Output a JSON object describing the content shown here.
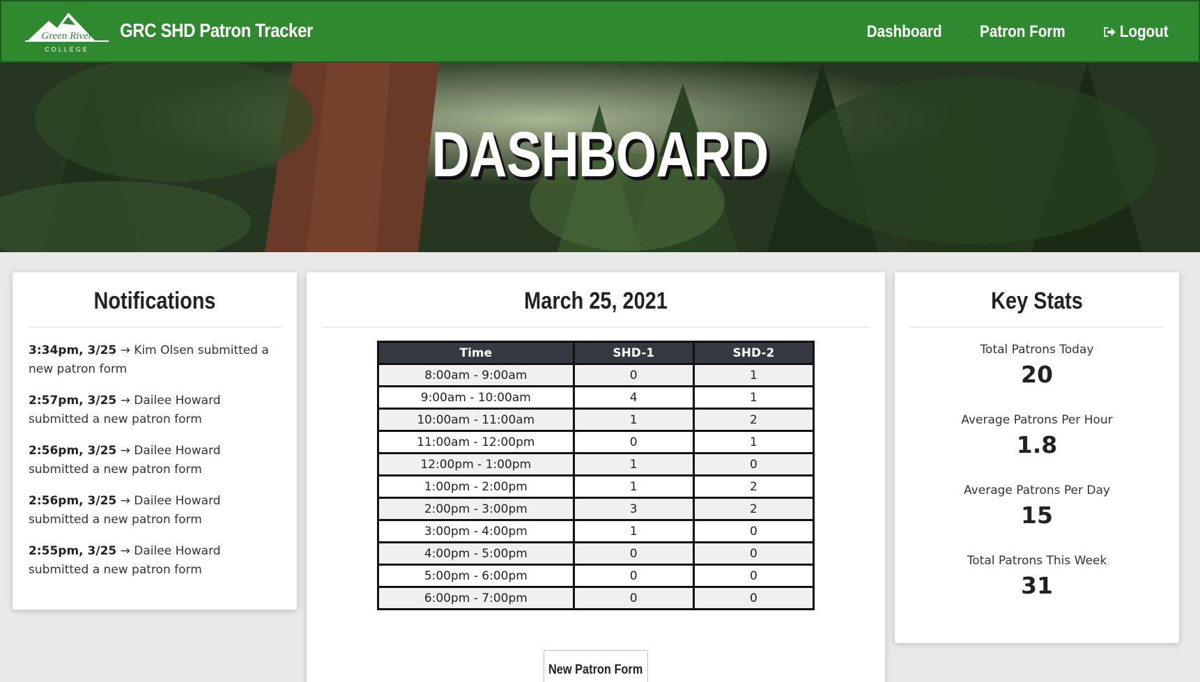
{
  "navbar": {
    "logo_text_top": "Green River",
    "logo_text_bottom": "COLLEGE",
    "brand": "GRC SHD Patron Tracker",
    "links": [
      "Dashboard",
      "Patron Form"
    ],
    "logout_label": "Logout"
  },
  "hero": {
    "title": "DASHBOARD"
  },
  "notifications": {
    "title": "Notifications",
    "items": [
      {
        "time": "3:34pm, 3/25",
        "text": " → Kim Olsen submitted a new patron form"
      },
      {
        "time": "2:57pm, 3/25",
        "text": " → Dailee Howard submitted a new patron form"
      },
      {
        "time": "2:56pm, 3/25",
        "text": " → Dailee Howard submitted a new patron form"
      },
      {
        "time": "2:56pm, 3/25",
        "text": " → Dailee Howard submitted a new patron form"
      },
      {
        "time": "2:55pm, 3/25",
        "text": " → Dailee Howard submitted a new patron form"
      }
    ]
  },
  "schedule": {
    "title": "March 25, 2021",
    "columns": [
      "Time",
      "SHD-1",
      "SHD-2"
    ],
    "rows": [
      [
        "8:00am - 9:00am",
        "0",
        "1"
      ],
      [
        "9:00am - 10:00am",
        "4",
        "1"
      ],
      [
        "10:00am - 11:00am",
        "1",
        "2"
      ],
      [
        "11:00am - 12:00pm",
        "0",
        "1"
      ],
      [
        "12:00pm - 1:00pm",
        "1",
        "0"
      ],
      [
        "1:00pm - 2:00pm",
        "1",
        "2"
      ],
      [
        "2:00pm - 3:00pm",
        "3",
        "2"
      ],
      [
        "3:00pm - 4:00pm",
        "1",
        "0"
      ],
      [
        "4:00pm - 5:00pm",
        "0",
        "0"
      ],
      [
        "5:00pm - 6:00pm",
        "0",
        "0"
      ],
      [
        "6:00pm - 7:00pm",
        "0",
        "0"
      ]
    ],
    "button_label": "New Patron Form"
  },
  "stats": {
    "title": "Key Stats",
    "items": [
      {
        "label": "Total Patrons Today",
        "value": "20"
      },
      {
        "label": "Average Patrons Per Hour",
        "value": "1.8"
      },
      {
        "label": "Average Patrons Per Day",
        "value": "15"
      },
      {
        "label": "Total Patrons This Week",
        "value": "31"
      }
    ]
  },
  "colors": {
    "nav_green": "#2f8a2f",
    "table_header": "#343a40",
    "background": "#e9e9e9"
  }
}
